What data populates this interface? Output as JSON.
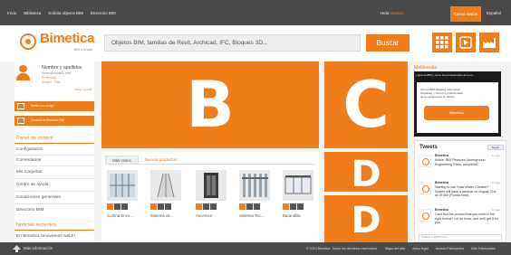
{
  "topbar": {
    "nav": [
      "Inicio",
      "Biblioteca",
      "Solicita objetos BIM",
      "Directorio BIM"
    ],
    "greeting": "Hola",
    "user": "Usuario",
    "login": "Cerrar sesión",
    "language": "Español"
  },
  "header": {
    "logo_name": "Bimetica",
    "logo_tag": "BIM a tu lado",
    "search_value": "Objetos BIM, familias de Revit, Archicad, IFC, Bloques 3D...",
    "search_button": "Buscar",
    "icons": [
      "grid-icon",
      "play-icon",
      "factory-icon"
    ]
  },
  "profile": {
    "name": "Nombre y apellidos",
    "email": "correo@dominio.com",
    "profession": "Profesión",
    "type": "Usuario · Free",
    "edit": "Editar tu perfil",
    "invite_button": "Invitar a un amigo",
    "directory_button": "Contacta el Directorio BIM"
  },
  "control_panel": {
    "title": "Panel de control",
    "items": [
      "Configuración",
      "Comentarios",
      "Mis Carpetas",
      "Centro de ayuda",
      "Condiciones generales",
      "Directorio BIM"
    ]
  },
  "recent_news": {
    "title": "Noticias recientes",
    "first": "En Bimetica renovamos web!!!"
  },
  "tiles": {
    "big_letter": "B",
    "c_letter": "C",
    "d_letter_1": "D",
    "d_letter_2": "D"
  },
  "products": {
    "tabs": [
      "Más vistos",
      "Nuevos productos"
    ],
    "items": [
      {
        "label": "Cortina Envo..."
      },
      {
        "label": "Sistema de..."
      },
      {
        "label": "Ascensor"
      },
      {
        "label": "Sistema Tec..."
      },
      {
        "label": "Barandilla"
      }
    ]
  },
  "multimedia": {
    "title": "Multimedia",
    "video_caption": "¿Qué es BIM y cómo los profesionales de la co...",
    "video_text": "Qué es BIM (Building Information Modeling) y cómo los profesionales de la construcción lo utilizan",
    "video_logo": "Bimetica"
  },
  "tweets": {
    "title": "Tweets",
    "follow": "Seguir",
    "items": [
      {
        "name": "Bimetica",
        "date": "14 ago",
        "text": "Article: BIM Reduces Underground Engineering Risks. ow.ly/b9dC"
      },
      {
        "name": "Bimetica",
        "date": "13 ago",
        "text": "Starting to use Solar Water Checker? Soldier will have a webinar on August 21st, at 10:30h (Florida time)."
      },
      {
        "name": "Bimetica",
        "date": "13 ago",
        "text": "Card find the product that you need in the right format? Let us know, and we'll get it for you."
      }
    ],
    "compose_placeholder": "Twittear a @Bimetica"
  },
  "footer": {
    "more": "Más información",
    "links": [
      "© 2014 Bimetica. Todos los derechos reservados.",
      "Mapa del sitio",
      "Aviso legal",
      "Acceso Fabricantes",
      "Más Fabricantes"
    ]
  }
}
